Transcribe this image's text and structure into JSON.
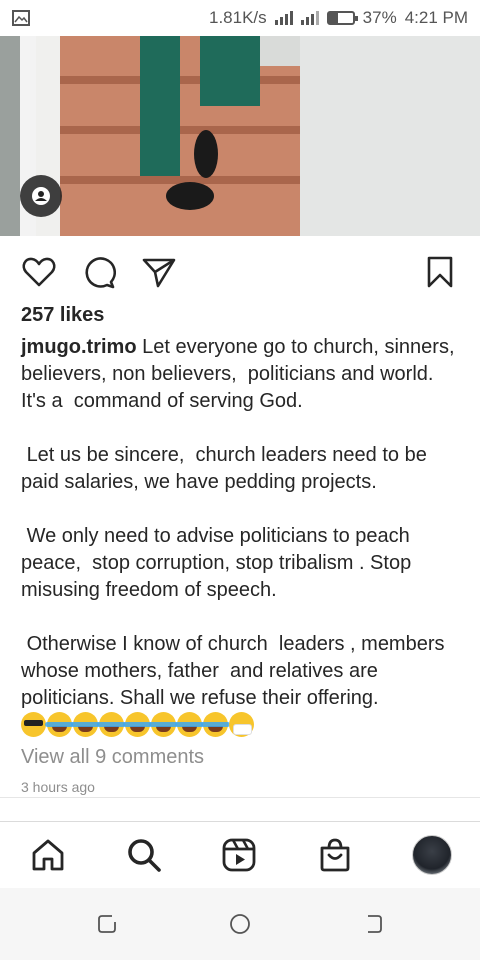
{
  "status_bar": {
    "speed": "1.81K/s",
    "battery_percent": "37%",
    "time": "4:21 PM",
    "battery_level": 0.37
  },
  "post": {
    "likes": "257 likes",
    "username": "jmugo.trimo",
    "caption": " Let everyone go to church, sinners, believers, non believers,  politicians and world. It's a  command of serving God.\n\n Let us be sincere,  church leaders need to be paid salaries, we have pedding projects.\n\n We only need to advise politicians to peach peace,  stop corruption, stop tribalism . Stop misusing freedom of speech.\n\n Otherwise I know of church  leaders , members whose mothers, father  and relatives are politicians. Shall we refuse their offering.",
    "emojis": [
      "sunglasses",
      "tears",
      "tears",
      "tears",
      "tears",
      "tears",
      "tears",
      "tears",
      "mask"
    ],
    "view_comments": "View all 9 comments",
    "timestamp": "3 hours ago"
  },
  "icons": {
    "gallery": "image-icon",
    "user_tag": "person-icon",
    "like": "heart-icon",
    "comment": "comment-icon",
    "share": "send-icon",
    "save": "bookmark-icon",
    "home": "home-icon",
    "search": "search-icon",
    "reels": "reels-icon",
    "shop": "shop-icon"
  },
  "colors": {
    "text": "#262626",
    "muted": "#8e8e8e"
  }
}
